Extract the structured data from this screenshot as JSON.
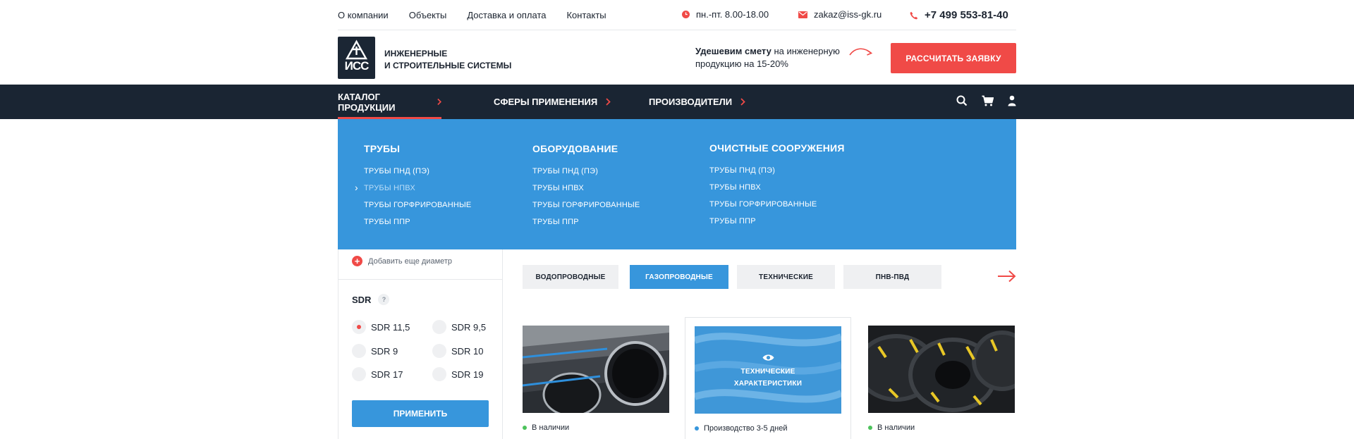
{
  "topbar": {
    "nav": [
      "О компании",
      "Объекты",
      "Доставка и оплата",
      "Контакты"
    ],
    "hours": "пн.-пт. 8.00-18.00",
    "email": "zakaz@iss-gk.ru",
    "phone": "+7 499 553-81-40"
  },
  "header": {
    "logo_text": "ИСС",
    "company_line1": "ИНЖЕНЕРНЫЕ",
    "company_line2": "И СТРОИТЕЛЬНЫЕ СИСТЕМЫ",
    "promo_bold": "Удешевим смету",
    "promo_rest1": " на инженерную",
    "promo_line2": "продукцию на 15-20%",
    "cta_label": "РАССЧИТАТЬ ЗАЯВКУ"
  },
  "mainnav": {
    "items": [
      "КАТАЛОГ ПРОДУКЦИИ",
      "СФЕРЫ ПРИМЕНЕНИЯ",
      "ПРОИЗВОДИТЕЛИ"
    ],
    "icons": [
      "search-icon",
      "cart-icon",
      "user-icon"
    ]
  },
  "mega": {
    "columns": [
      {
        "title": "ТРУБЫ",
        "items": [
          "ТРУБЫ ПНД (ПЭ)",
          "ТРУБЫ НПВХ",
          "ТРУБЫ ГОРФРИРОВАННЫЕ",
          "ТРУБЫ ППР"
        ]
      },
      {
        "title": "ОБОРУДОВАНИЕ",
        "items": [
          "ТРУБЫ ПНД (ПЭ)",
          "ТРУБЫ НПВХ",
          "ТРУБЫ ГОРФРИРОВАННЫЕ",
          "ТРУБЫ ППР"
        ]
      },
      {
        "title": "ОЧИСТНЫЕ СООРУЖЕНИЯ",
        "items": [
          "ТРУБЫ ПНД (ПЭ)",
          "ТРУБЫ НПВХ",
          "ТРУБЫ ГОРФРИРОВАННЫЕ",
          "ТРУБЫ ППР"
        ]
      }
    ]
  },
  "sidebar": {
    "add_diameter": "Добавить еще диаметр",
    "sdr_title": "SDR",
    "help": "?",
    "options": [
      "SDR 11,5",
      "SDR 9,5",
      "SDR 9",
      "SDR 10",
      "SDR 17",
      "SDR 19"
    ],
    "selected": "SDR 11,5",
    "apply": "ПРИМЕНИТЬ"
  },
  "filters": {
    "tabs": [
      "ВОДОПРОВОДНЫЕ",
      "ГАЗОПРОВОДНЫЕ",
      "ТЕХНИЧЕСКИЕ",
      "ПНВ-ПВД"
    ],
    "active": "ГАЗОПРОВОДНЫЕ"
  },
  "products": [
    {
      "status": "В наличии",
      "status_color": "#4cc25b"
    },
    {
      "status": "Производство 3-5 дней",
      "status_color": "#3796dc",
      "overlay_line1": "ТЕХНИЧЕСКИЕ",
      "overlay_line2": "ХАРАКТЕРИСТИКИ"
    },
    {
      "status": "В наличии",
      "status_color": "#4cc25b"
    }
  ],
  "colors": {
    "accent": "#f04a47",
    "blue": "#3796dc",
    "dark": "#1a2533"
  }
}
